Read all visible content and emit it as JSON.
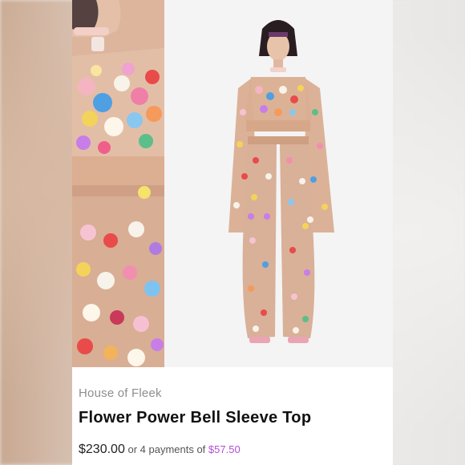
{
  "product": {
    "brand": "House of Fleek",
    "title": "Flower Power Bell Sleeve Top",
    "price": "$230.00",
    "installment_prefix": "or 4 payments of",
    "installment_amount": "$57.50"
  },
  "colors": {
    "installment_accent": "#b14fd8",
    "skin_tone": "#d9b49a",
    "hair": "#2a1d22"
  },
  "images": {
    "closeup_photo_icon": "flower-closeup-photo",
    "fullshot_photo_icon": "model-full-length-photo"
  }
}
